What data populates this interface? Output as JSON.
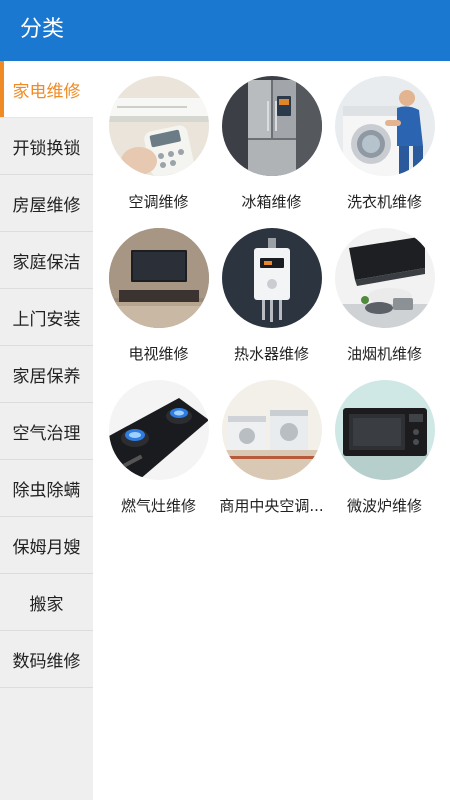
{
  "header": {
    "title": "分类"
  },
  "sidebar": {
    "items": [
      {
        "label": "家电维修",
        "active": true
      },
      {
        "label": "开锁换锁",
        "active": false
      },
      {
        "label": "房屋维修",
        "active": false
      },
      {
        "label": "家庭保洁",
        "active": false
      },
      {
        "label": "上门安装",
        "active": false
      },
      {
        "label": "家居保养",
        "active": false
      },
      {
        "label": "空气治理",
        "active": false
      },
      {
        "label": "除虫除螨",
        "active": false
      },
      {
        "label": "保姆月嫂",
        "active": false
      },
      {
        "label": "搬家",
        "active": false
      },
      {
        "label": "数码维修",
        "active": false
      }
    ]
  },
  "categories": [
    {
      "label": "空调维修",
      "image": "air-conditioner-photo"
    },
    {
      "label": "冰箱维修",
      "image": "refrigerator-photo"
    },
    {
      "label": "洗衣机维修",
      "image": "washing-machine-photo"
    },
    {
      "label": "电视维修",
      "image": "television-photo"
    },
    {
      "label": "热水器维修",
      "image": "water-heater-photo"
    },
    {
      "label": "油烟机维修",
      "image": "range-hood-photo"
    },
    {
      "label": "燃气灶维修",
      "image": "gas-stove-photo"
    },
    {
      "label": "商用中央空调...",
      "image": "central-ac-photo"
    },
    {
      "label": "微波炉维修",
      "image": "microwave-photo"
    }
  ],
  "colors": {
    "header": "#1b78d0",
    "accent": "#f08a24",
    "sidebar_bg": "#efefef"
  }
}
